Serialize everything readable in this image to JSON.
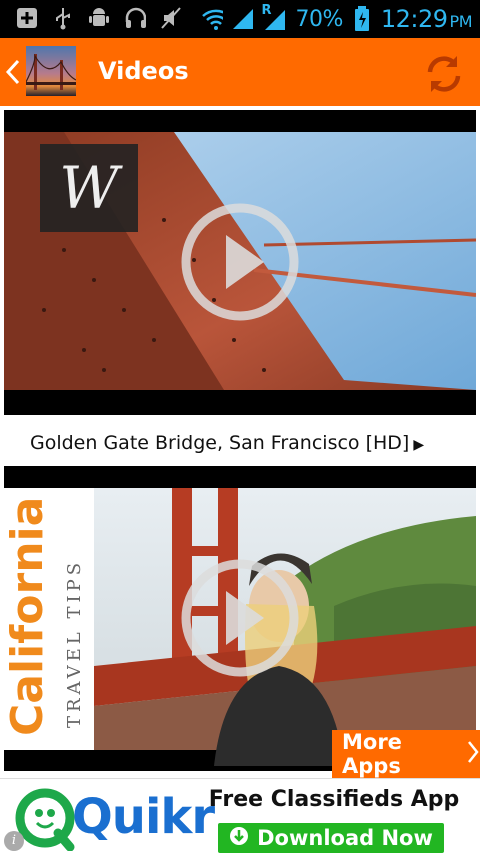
{
  "status_bar": {
    "battery_percent": "70%",
    "time": "12:29",
    "ampm": "PM",
    "roaming_indicator": "R",
    "icons": [
      "add-icon",
      "usb-icon",
      "android-icon",
      "headphones-icon",
      "mute-icon",
      "wifi-icon",
      "signal-icon",
      "roaming-signal-icon",
      "battery-charging-icon"
    ]
  },
  "action_bar": {
    "title": "Videos",
    "back_icon": "chevron-left-icon",
    "refresh_icon": "refresh-icon"
  },
  "videos": [
    {
      "title": "Golden Gate Bridge, San Francisco [HD]",
      "arrow": "▶",
      "thumb_logo": "W"
    },
    {
      "title": "",
      "arrow": "",
      "thumb_logo": "California",
      "thumb_subtitle": "TRAVEL TIPS"
    }
  ],
  "more_apps": {
    "label": "More Apps",
    "icon": "chevron-right-icon"
  },
  "ad": {
    "brand": "Quikr",
    "headline": "Free Classifieds App",
    "button_label": "Download Now",
    "info_label": "i"
  },
  "colors": {
    "accent": "#ff6a00",
    "status_blue": "#2fb7f0",
    "ad_green": "#22b622"
  }
}
